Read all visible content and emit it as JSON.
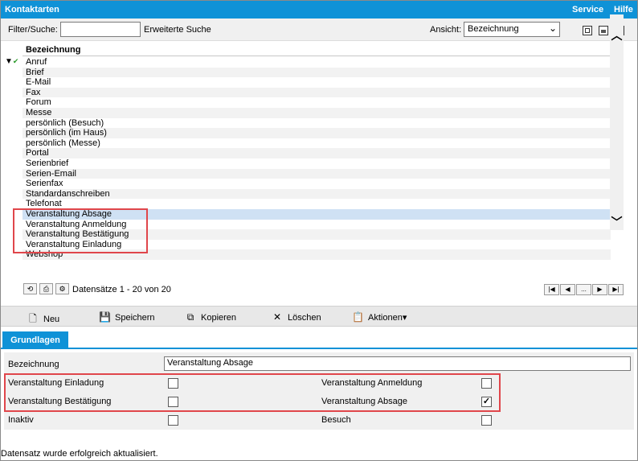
{
  "titlebar": {
    "title": "Kontaktarten",
    "service": "Service",
    "help": "Hilfe"
  },
  "filterbar": {
    "filter_label": "Filter/Suche:",
    "filter_value": "",
    "advanced_search": "Erweiterte Suche",
    "view_label": "Ansicht:",
    "view_value": "Bezeichnung"
  },
  "list": {
    "column_header": "Bezeichnung",
    "rows": [
      "Anruf",
      "Brief",
      "E-Mail",
      "Fax",
      "Forum",
      "Messe",
      "persönlich (Besuch)",
      "persönlich (im Haus)",
      "persönlich (Messe)",
      "Portal",
      "Serienbrief",
      "Serien-Email",
      "Serienfax",
      "Standardanschreiben",
      "Telefonat",
      "Veranstaltung Absage",
      "Veranstaltung Anmeldung",
      "Veranstaltung Bestätigung",
      "Veranstaltung Einladung",
      "Webshop"
    ],
    "selected_row": "Veranstaltung Absage"
  },
  "pager": {
    "count_text": "Datensätze 1 - 20 von 20",
    "ellipsis": "..."
  },
  "toolbar": {
    "new": "Neu",
    "save": "Speichern",
    "copy": "Kopieren",
    "delete": "Löschen",
    "actions": "Aktionen"
  },
  "tabs": {
    "basics": "Grundlagen"
  },
  "form": {
    "name_label": "Bezeichnung",
    "name_value": "Veranstaltung Absage",
    "fields": {
      "einladung": {
        "label": "Veranstaltung Einladung",
        "checked": false
      },
      "anmeldung": {
        "label": "Veranstaltung Anmeldung",
        "checked": false
      },
      "bestaetigung": {
        "label": "Veranstaltung Bestätigung",
        "checked": false
      },
      "absage": {
        "label": "Veranstaltung Absage",
        "checked": true
      },
      "inaktiv": {
        "label": "Inaktiv",
        "checked": false
      },
      "besuch": {
        "label": "Besuch",
        "checked": false
      }
    }
  },
  "status": {
    "message": "Datensatz wurde erfolgreich aktualisiert."
  },
  "colors": {
    "accent": "#0f92d7",
    "highlight": "#e0464b",
    "selection": "#cfe1f4"
  }
}
